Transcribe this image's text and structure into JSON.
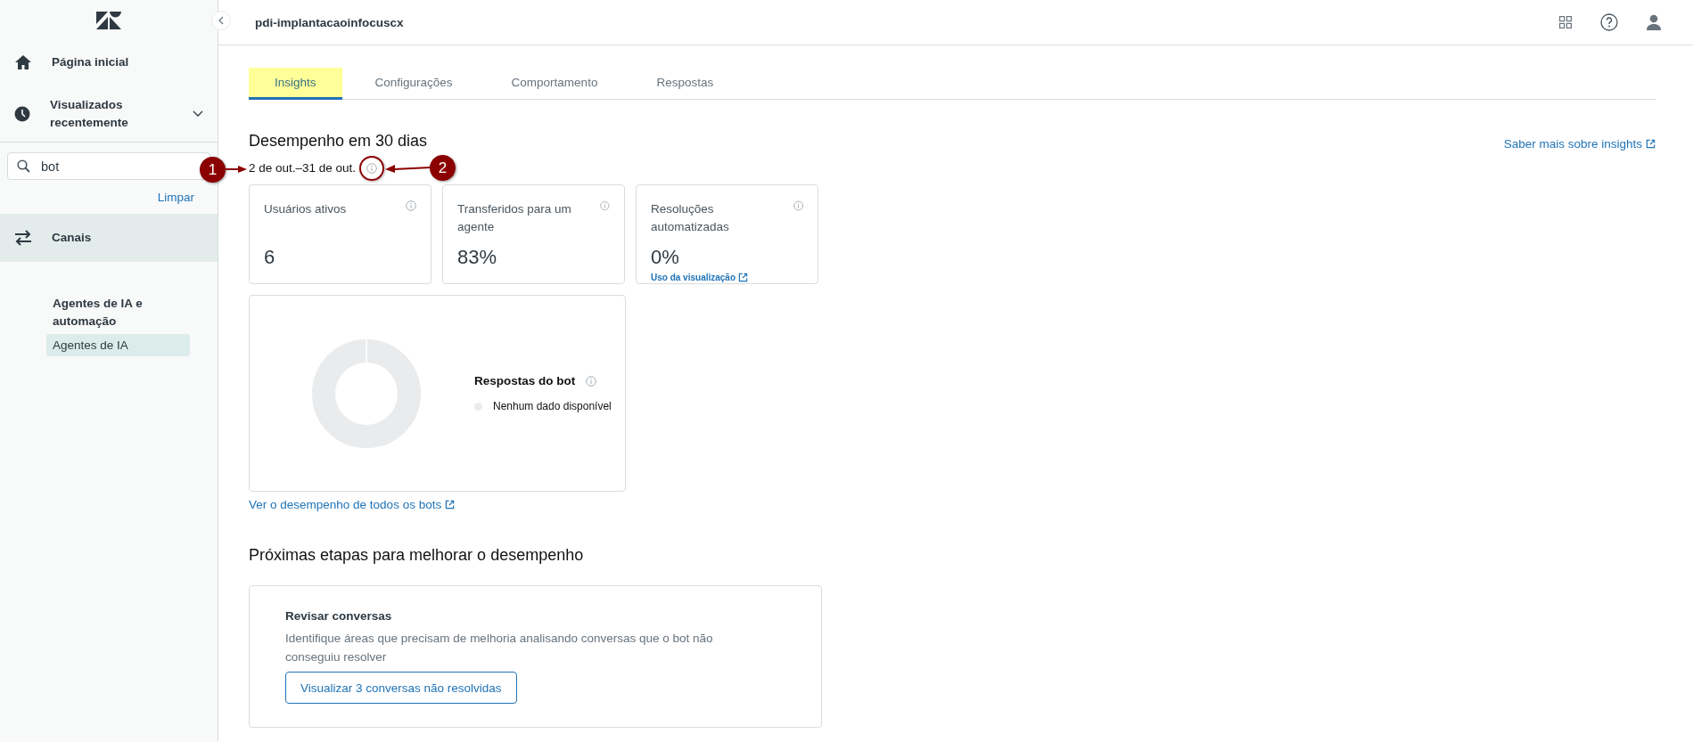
{
  "header": {
    "title": "pdi-implantacaoinfocuscx"
  },
  "sidebar": {
    "nav": [
      {
        "label": "Página inicial",
        "kind": "home",
        "selected": false
      },
      {
        "label": "Visualizados recentemente",
        "kind": "recent",
        "expanded": false,
        "selected": false
      }
    ],
    "search": {
      "value": "bot"
    },
    "clear_link": "Limpar",
    "results": [
      {
        "label": "Canais",
        "kind": "channels",
        "selected": true
      }
    ],
    "section": {
      "title": "Agentes de IA e automação",
      "items": [
        {
          "label": "Agentes de IA",
          "selected": true
        }
      ]
    }
  },
  "tabs": [
    {
      "label": "Insights",
      "selected": true,
      "highlighted": true
    },
    {
      "label": "Configurações",
      "selected": false,
      "highlighted": false
    },
    {
      "label": "Comportamento",
      "selected": false,
      "highlighted": false
    },
    {
      "label": "Respostas",
      "selected": false,
      "highlighted": false
    }
  ],
  "performance": {
    "title": "Desempenho em 30 dias",
    "date_range": "2 de out.–31 de out.",
    "learn_more_link": "Saber mais sobre insights",
    "metrics": [
      {
        "label": "Usuários ativos",
        "value": "6"
      },
      {
        "label": "Transferidos para um agente",
        "value": "83%"
      },
      {
        "label": "Resoluções automatizadas",
        "value": "0%",
        "link": "Uso da visualização"
      }
    ],
    "bot_responses": {
      "title": "Respostas do bot",
      "legend": [
        {
          "label": "Nenhum dado disponível",
          "color": "#e9ebed"
        }
      ]
    },
    "all_bots_link": "Ver o desempenho de todos os bots"
  },
  "next_steps": {
    "title": "Próximas etapas para melhorar o desempenho",
    "cards": [
      {
        "title": "Revisar conversas",
        "description": "Identifique áreas que precisam de melhoria analisando conversas que o bot não conseguiu resolver",
        "button": "Visualizar 3 conversas não resolvidas"
      }
    ]
  },
  "annotations": [
    {
      "label": "1"
    },
    {
      "label": "2"
    }
  ]
}
